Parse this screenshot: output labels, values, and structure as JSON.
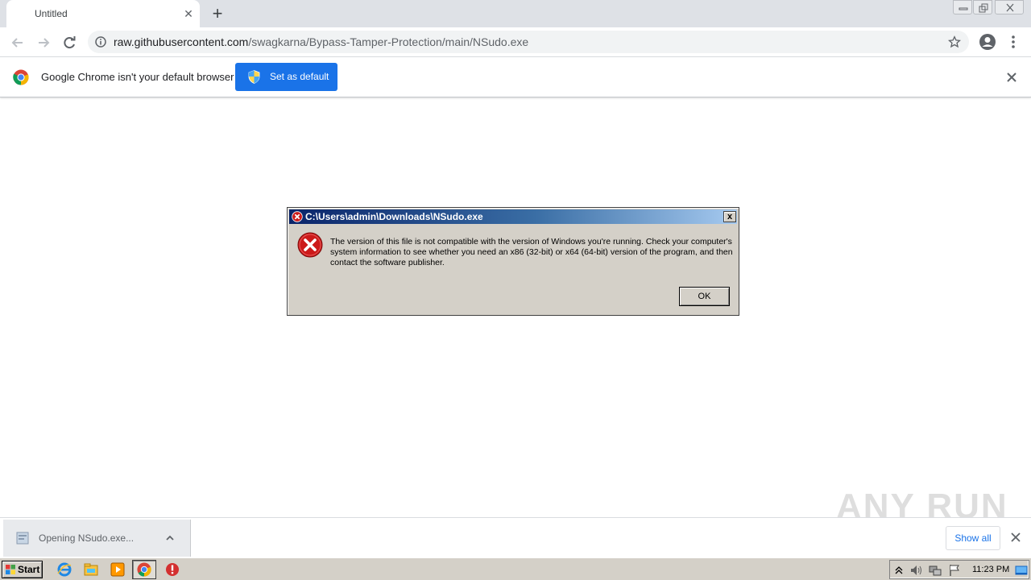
{
  "browser": {
    "tab_title": "Untitled",
    "url_host": "raw.githubusercontent.com",
    "url_path": "/swagkarna/Bypass-Tamper-Protection/main/NSudo.exe"
  },
  "infobar": {
    "message": "Google Chrome isn't your default browser",
    "button_label": "Set as default"
  },
  "dialog": {
    "title": "C:\\Users\\admin\\Downloads\\NSudo.exe",
    "close_glyph": "x",
    "message": "The version of this file is not compatible with the version of Windows you're running. Check your computer's system information to see whether you need an x86 (32-bit) or x64 (64-bit) version of the program, and then contact the software publisher.",
    "ok_label": "OK"
  },
  "download_shelf": {
    "item_label": "Opening NSudo.exe...",
    "show_all_label": "Show all"
  },
  "watermark": "ANY RUN",
  "taskbar": {
    "start_label": "Start",
    "clock": "11:23 PM"
  },
  "colors": {
    "accent": "#1a73e8",
    "titlebar_start": "#0a246a",
    "titlebar_end": "#a6caf0",
    "error_red": "#cc1a1a"
  }
}
